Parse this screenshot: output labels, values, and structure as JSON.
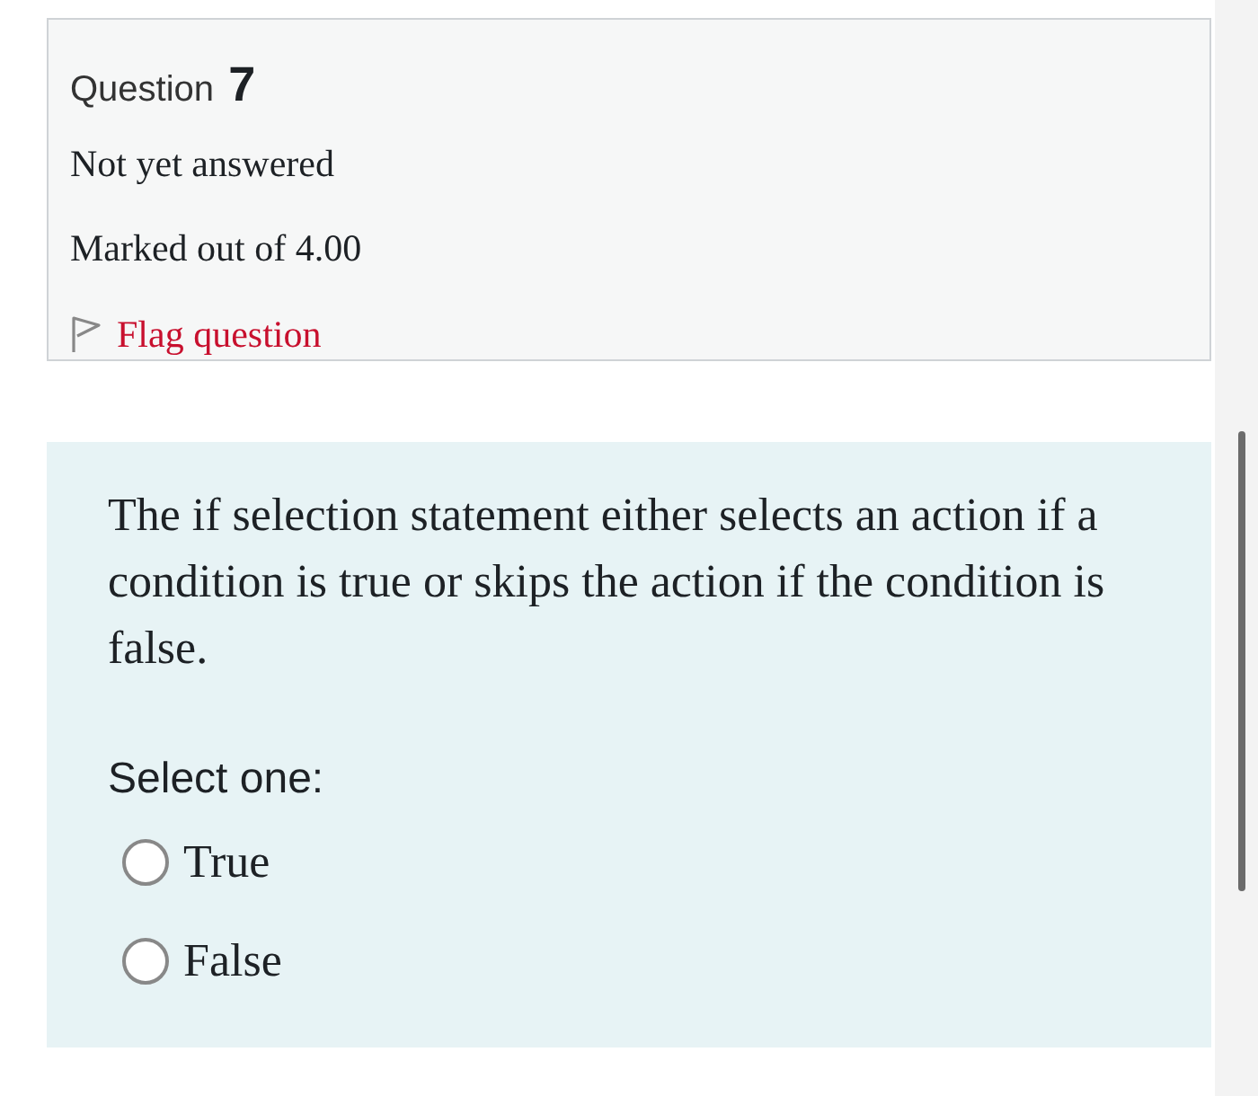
{
  "info": {
    "question_label": "Question",
    "question_number": "7",
    "status": "Not yet answered",
    "marks": "Marked out of 4.00",
    "flag": {
      "label": "Flag question",
      "flagged": false
    }
  },
  "question": {
    "text": "The if selection statement either selects an action if a condition is true or skips the action if the condition is false.",
    "prompt": "Select one:",
    "options": [
      {
        "label": "True",
        "selected": false
      },
      {
        "label": "False",
        "selected": false
      }
    ]
  }
}
